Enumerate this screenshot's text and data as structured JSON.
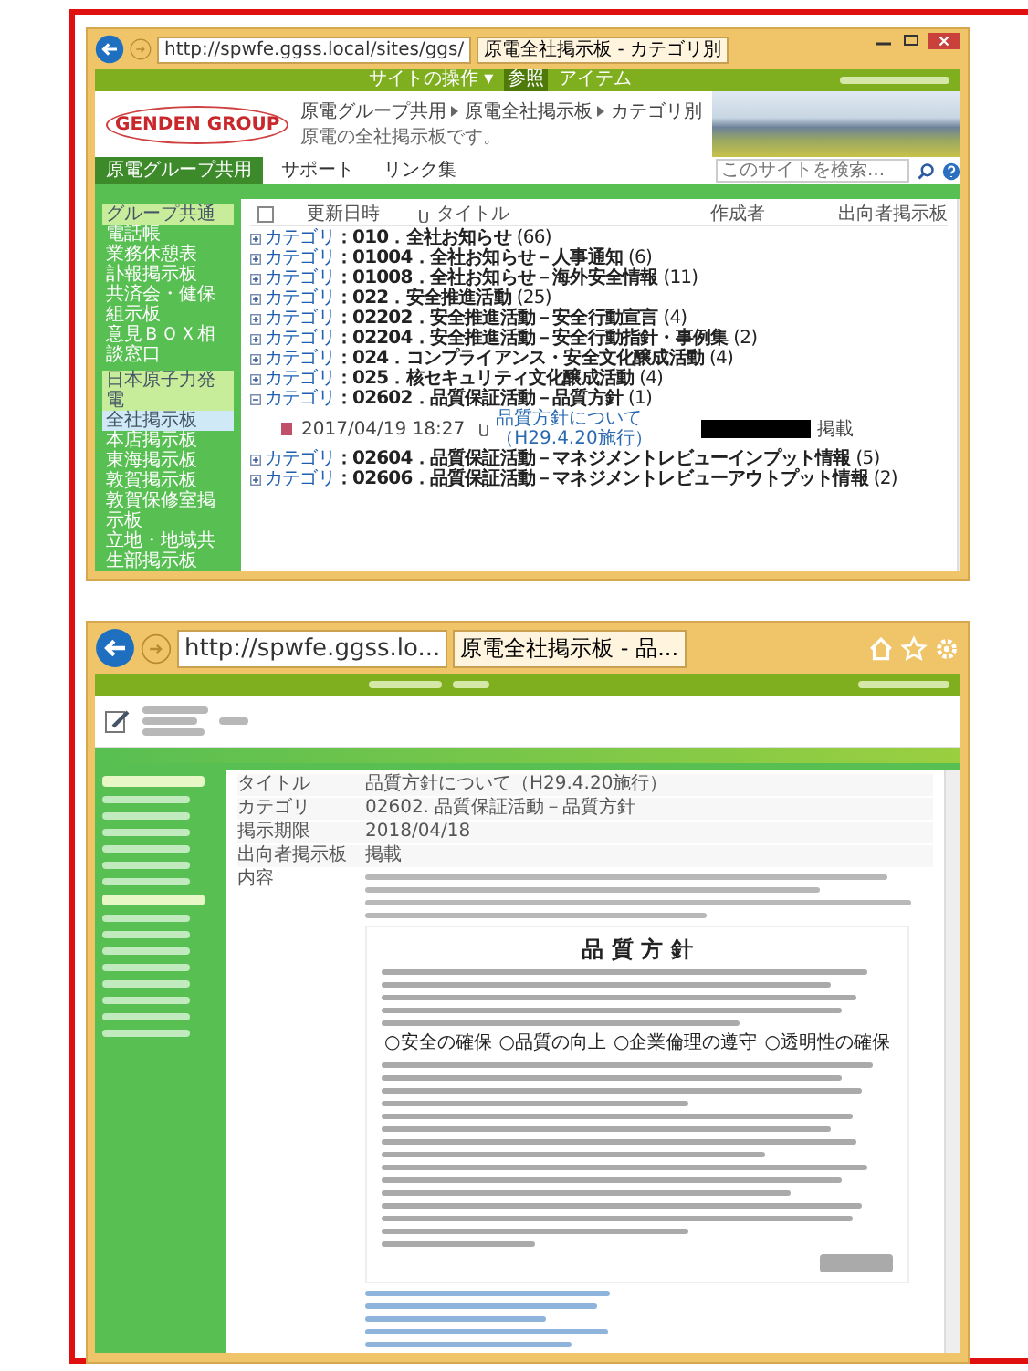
{
  "list_window": {
    "address": "http://spwfe.ggss.local/sites/ggs/",
    "tab_title": "原電全社掲示板 - カテゴリ別",
    "ribbon_tabs": [
      {
        "label": "サイトの操作 ▾",
        "selected": false
      },
      {
        "label": "参照",
        "selected": true
      },
      {
        "label": "アイテム",
        "selected": false
      }
    ],
    "logo": "GENDEN GROUP",
    "breadcrumb": [
      "原電グループ共用",
      "原電全社掲示板",
      "カテゴリ別"
    ],
    "subtitle": "原電の全社掲示板です。",
    "nav": [
      {
        "label": "原電グループ共用",
        "selected": true
      },
      {
        "label": "サポート",
        "selected": false
      },
      {
        "label": "リンク集",
        "selected": false
      }
    ],
    "search": {
      "placeholder": "このサイトを検索..."
    },
    "sidebar": [
      {
        "label": "グループ共通",
        "kind": "header",
        "selected": false
      },
      {
        "label": "電話帳",
        "kind": "item",
        "selected": false
      },
      {
        "label": "業務休憩表",
        "kind": "item",
        "selected": false
      },
      {
        "label": "訃報掲示板",
        "kind": "item",
        "selected": false
      },
      {
        "label": "共済会・健保組示板",
        "kind": "item",
        "selected": false
      },
      {
        "label": "意見ＢＯＸ相談窓口",
        "kind": "item",
        "selected": false
      },
      {
        "label": "日本原子力発電",
        "kind": "header",
        "selected": false
      },
      {
        "label": "全社掲示板",
        "kind": "item",
        "selected": true
      },
      {
        "label": "本店掲示板",
        "kind": "item",
        "selected": false
      },
      {
        "label": "東海掲示板",
        "kind": "item",
        "selected": false
      },
      {
        "label": "敦賀掲示板",
        "kind": "item",
        "selected": false
      },
      {
        "label": "敦賀保修室掲示板",
        "kind": "item",
        "selected": false
      },
      {
        "label": "立地・地域共生部掲示板",
        "kind": "item",
        "selected": false
      }
    ],
    "select_all_checked": false,
    "columns": [
      "更新日時",
      "タイトル",
      "作成者",
      "出向者掲示板"
    ],
    "groups": [
      {
        "prefix": "カテゴリ",
        "name": "：010．全社お知らせ",
        "count": "(66)",
        "expanded": false
      },
      {
        "prefix": "カテゴリ",
        "name": "：01004．全社お知らせ－人事通知",
        "count": "(6)",
        "expanded": false
      },
      {
        "prefix": "カテゴリ",
        "name": "：01008．全社お知らせ－海外安全情報",
        "count": "(11)",
        "expanded": false
      },
      {
        "prefix": "カテゴリ",
        "name": "：022．安全推進活動",
        "count": "(25)",
        "expanded": false
      },
      {
        "prefix": "カテゴリ",
        "name": "：02202．安全推進活動－安全行動宣言",
        "count": "(4)",
        "expanded": false
      },
      {
        "prefix": "カテゴリ",
        "name": "：02204．安全推進活動－安全行動指針・事例集",
        "count": "(2)",
        "expanded": false
      },
      {
        "prefix": "カテゴリ",
        "name": "：024．コンプライアンス・安全文化醸成活動",
        "count": "(4)",
        "expanded": false
      },
      {
        "prefix": "カテゴリ",
        "name": "：025．核セキュリティ文化醸成活動",
        "count": "(4)",
        "expanded": false
      },
      {
        "prefix": "カテゴリ",
        "name": "：02602．品質保証活動－品質方針",
        "count": "(1)",
        "expanded": true,
        "items": [
          {
            "date": "2017/04/19 18:27",
            "title": "品質方針について（H29.4.20施行）",
            "author_redacted": true,
            "status": "掲載"
          }
        ]
      },
      {
        "prefix": "カテゴリ",
        "name": "：02604．品質保証活動－マネジメントレビューインプット情報",
        "count": "(5)",
        "expanded": false
      },
      {
        "prefix": "カテゴリ",
        "name": "：02606．品質保証活動－マネジメントレビューアウトプット情報",
        "count": "(2)",
        "expanded": false
      }
    ]
  },
  "detail_window": {
    "address": "http://spwfe.ggss.lo...",
    "tab_title": "原電全社掲示板 - 品...",
    "fields": [
      {
        "label": "タイトル",
        "value": "品質方針について（H29.4.20施行）"
      },
      {
        "label": "カテゴリ",
        "value": "02602. 品質保証活動－品質方針"
      },
      {
        "label": "掲示期限",
        "value": "2018/04/18"
      },
      {
        "label": "出向者掲示板",
        "value": "掲載"
      }
    ],
    "content_label": "内容",
    "doc_title": "品 質 方 針",
    "principles": [
      "○安全の確保",
      "○品質の向上",
      "○企業倫理の遵守",
      "○透明性の確保"
    ]
  }
}
